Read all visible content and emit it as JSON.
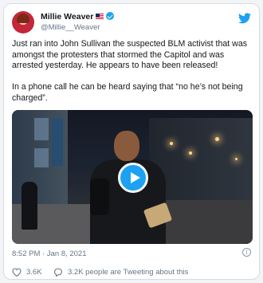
{
  "tweet": {
    "display_name": "Millie Weaver",
    "handle": "@Millie__Weaver",
    "paragraphs": [
      "Just ran into John Sullivan the suspected BLM activist that was amongst the protesters that stormed the Capitol and was arrested yesterday. He appears to have been released!",
      "In a phone call he can be heard saying that “no he’s not being charged”."
    ],
    "timestamp": "8:52 PM · Jan 8, 2021",
    "likes": "3.6K",
    "tweeting": "3.2K people are Tweeting about this"
  },
  "colors": {
    "brand": "#1da1f2",
    "text": "#14171a",
    "secondary": "#657786"
  },
  "icons": {
    "logo": "twitter-bird-icon",
    "verified": "verified-badge-icon",
    "play": "play-icon",
    "info": "info-icon",
    "like": "heart-icon",
    "reply": "speech-bubble-icon"
  }
}
